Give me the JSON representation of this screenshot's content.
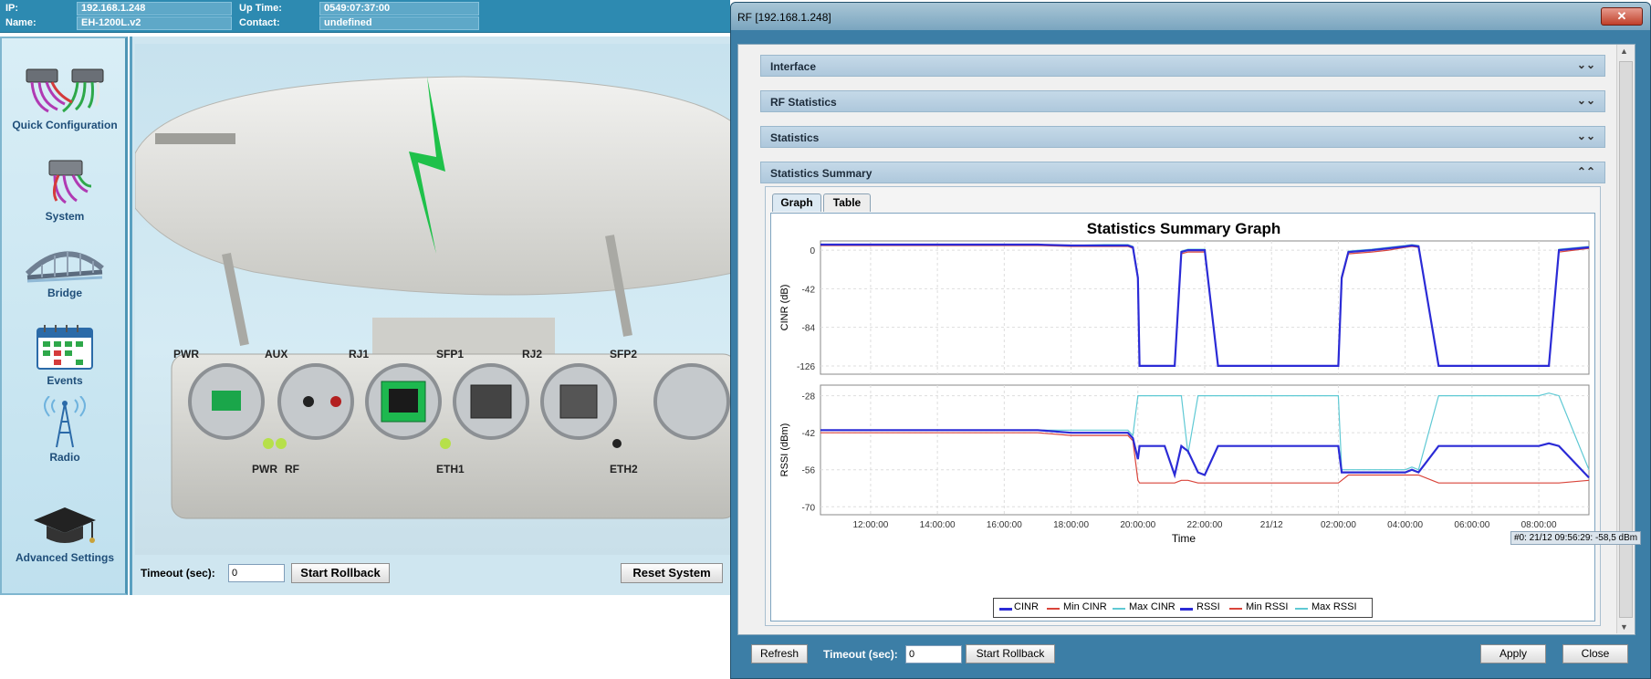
{
  "info": {
    "ip_label": "IP:",
    "ip_value": "192.168.1.248",
    "name_label": "Name:",
    "name_value": "EH-1200L.v2",
    "uptime_label": "Up Time:",
    "uptime_value": "0549:07:37:00",
    "contact_label": "Contact:",
    "contact_value": "undefined"
  },
  "nav": {
    "items": [
      {
        "label": "Quick Configuration",
        "icon": "network-devices-icon"
      },
      {
        "label": "System",
        "icon": "device-cables-icon"
      },
      {
        "label": "Bridge",
        "icon": "bridge-icon"
      },
      {
        "label": "Events",
        "icon": "calendar-icon"
      },
      {
        "label": "Radio",
        "icon": "radio-tower-icon"
      },
      {
        "label": "Advanced Settings",
        "icon": "graduation-cap-icon"
      }
    ]
  },
  "device": {
    "ports": [
      "PWR",
      "AUX",
      "RJ1",
      "SFP1",
      "RJ2",
      "SFP2"
    ],
    "leds": [
      "PWR",
      "RF",
      "ETH1",
      "ETH2"
    ]
  },
  "main_footer": {
    "timeout_label": "Timeout (sec):",
    "timeout_value": "0",
    "start_rollback": "Start Rollback",
    "reset_system": "Reset System"
  },
  "dialog": {
    "title": "RF [192.168.1.248]",
    "close_glyph": "✕",
    "sections": [
      "Interface",
      "RF Statistics",
      "Statistics",
      "Statistics Summary"
    ],
    "collapsed_glyph": "⌄⌄",
    "expanded_glyph": "⌃⌃",
    "tabs": [
      "Graph",
      "Table"
    ],
    "active_tab": "Graph",
    "tooltip": "#0: 21/12 09:56:29: -58,5 dBm",
    "footer": {
      "refresh": "Refresh",
      "timeout_label": "Timeout (sec):",
      "timeout_value": "0",
      "start_rollback": "Start Rollback",
      "apply": "Apply",
      "close": "Close"
    }
  },
  "colors": {
    "cinr": "#2b2bd6",
    "min_cinr": "#d9443a",
    "max_cinr": "#5fc9d4",
    "rssi": "#2b2bd6",
    "min_rssi": "#d9443a",
    "max_rssi": "#5fc9d4",
    "accent": "#2d8ab1"
  },
  "chart_data": {
    "type": "line",
    "title": "Statistics Summary Graph",
    "xlabel": "Time",
    "x_ticks": [
      "12:00:00",
      "14:00:00",
      "16:00:00",
      "18:00:00",
      "20:00:00",
      "22:00:00",
      "21/12",
      "02:00:00",
      "04:00:00",
      "06:00:00",
      "08:00:00"
    ],
    "x": [
      10.5,
      12,
      13,
      14,
      15,
      16,
      17,
      18,
      19,
      19.7,
      19.85,
      20,
      20.05,
      20.8,
      21.1,
      21.3,
      21.5,
      21.8,
      22,
      22.4,
      23,
      24,
      25,
      26,
      26.1,
      26.3,
      27,
      27.5,
      28,
      28.2,
      28.4,
      29,
      30,
      31,
      32,
      32.3,
      32.6,
      33.5
    ],
    "panels": [
      {
        "ylabel": "CINR (dB)",
        "y_ticks": [
          0,
          -42,
          -84,
          -126
        ],
        "ylim": [
          -135,
          10
        ],
        "series": [
          {
            "name": "CINR",
            "values": [
              6,
              6,
              6,
              6,
              6,
              6,
              6,
              5,
              5,
              5,
              3,
              -30,
              -126,
              -126,
              -126,
              -2,
              0,
              0,
              0,
              -126,
              -126,
              -126,
              -126,
              -126,
              -30,
              -2,
              0,
              2,
              4,
              5,
              4,
              -126,
              -126,
              -126,
              -126,
              -126,
              0,
              3
            ]
          },
          {
            "name": "Min CINR",
            "values": [
              5,
              5,
              5,
              5,
              5,
              5,
              5,
              4,
              4,
              4,
              2,
              -32,
              -126,
              -126,
              -126,
              -4,
              -2,
              -2,
              -2,
              -126,
              -126,
              -126,
              -126,
              -126,
              -32,
              -4,
              -2,
              0,
              3,
              4,
              3,
              -126,
              -126,
              -126,
              -126,
              -126,
              -2,
              2
            ]
          },
          {
            "name": "Max CINR",
            "values": [
              6,
              6,
              6,
              6,
              6,
              6,
              6,
              5,
              6,
              6,
              4,
              -28,
              -126,
              -126,
              -126,
              -1,
              1,
              1,
              1,
              -126,
              -126,
              -126,
              -126,
              -126,
              -28,
              -1,
              1,
              3,
              5,
              6,
              5,
              -126,
              -126,
              -126,
              -126,
              -126,
              1,
              4
            ]
          }
        ]
      },
      {
        "ylabel": "RSSI (dBm)",
        "y_ticks": [
          -28,
          -42,
          -56,
          -70
        ],
        "ylim": [
          -73,
          -24
        ],
        "series": [
          {
            "name": "RSSI",
            "values": [
              -41,
              -41,
              -41,
              -41,
              -41,
              -41,
              -41,
              -42,
              -42,
              -42,
              -44,
              -52,
              -47,
              -47,
              -58,
              -47,
              -49,
              -57,
              -58,
              -47,
              -47,
              -47,
              -47,
              -47,
              -57,
              -57,
              -57,
              -57,
              -57,
              -56,
              -57,
              -47,
              -47,
              -47,
              -47,
              -46,
              -47,
              -59
            ]
          },
          {
            "name": "Min RSSI",
            "values": [
              -42,
              -42,
              -42,
              -42,
              -42,
              -42,
              -42,
              -43,
              -43,
              -43,
              -45,
              -60,
              -61,
              -61,
              -61,
              -60,
              -60,
              -61,
              -61,
              -61,
              -61,
              -61,
              -61,
              -61,
              -60,
              -58,
              -58,
              -58,
              -58,
              -58,
              -58,
              -61,
              -61,
              -61,
              -61,
              -61,
              -61,
              -60
            ]
          },
          {
            "name": "Max RSSI",
            "values": [
              -41,
              -41,
              -41,
              -41,
              -41,
              -41,
              -41,
              -41,
              -41,
              -41,
              -43,
              -28,
              -28,
              -28,
              -28,
              -28,
              -50,
              -28,
              -28,
              -28,
              -28,
              -28,
              -28,
              -28,
              -56,
              -56,
              -56,
              -56,
              -56,
              -55,
              -56,
              -28,
              -28,
              -28,
              -28,
              -27,
              -28,
              -56
            ]
          }
        ]
      }
    ],
    "legend_position": "bottom-center",
    "grid": true
  }
}
